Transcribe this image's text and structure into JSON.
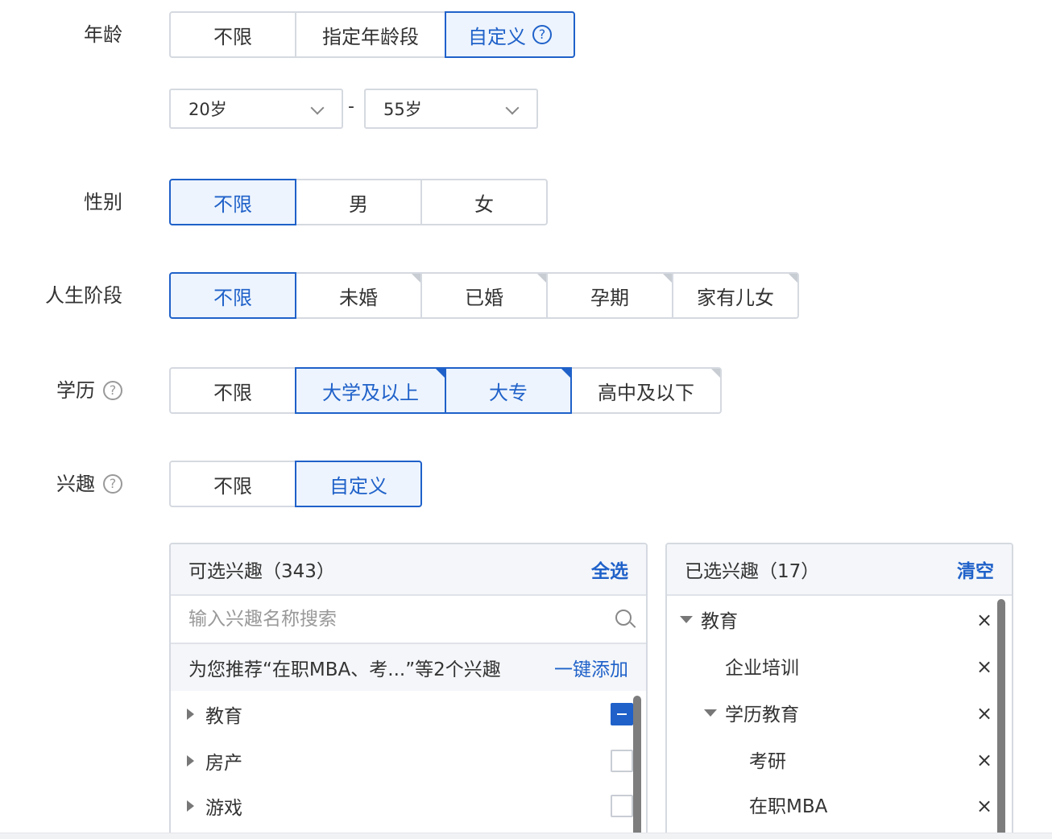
{
  "age": {
    "label": "年龄",
    "options": [
      "不限",
      "指定年龄段",
      "自定义"
    ],
    "selected": "自定义",
    "help_icon": "question-circle-icon",
    "from": "20岁",
    "to": "55岁",
    "range_sep": "-"
  },
  "gender": {
    "label": "性别",
    "options": [
      "不限",
      "男",
      "女"
    ],
    "selected": "不限"
  },
  "life_stage": {
    "label": "人生阶段",
    "options": [
      "不限",
      "未婚",
      "已婚",
      "孕期",
      "家有儿女"
    ],
    "selected": "不限"
  },
  "education": {
    "label": "学历",
    "help_icon": "question-circle-icon",
    "options": [
      "不限",
      "大学及以上",
      "大专",
      "高中及以下"
    ],
    "selected": [
      "大学及以上",
      "大专"
    ]
  },
  "interest": {
    "label": "兴趣",
    "help_icon": "question-circle-icon",
    "options": [
      "不限",
      "自定义"
    ],
    "selected": "自定义"
  },
  "available_panel": {
    "title": "可选兴趣（343）",
    "select_all": "全选",
    "search_placeholder": "输入兴趣名称搜索",
    "recommend_text": "为您推荐“在职MBA、考...”等2个兴趣",
    "recommend_action": "一键添加",
    "items": [
      {
        "label": "教育",
        "state": "partial"
      },
      {
        "label": "房产",
        "state": "unchecked"
      },
      {
        "label": "游戏",
        "state": "unchecked"
      }
    ]
  },
  "selected_panel": {
    "title": "已选兴趣（17）",
    "clear": "清空",
    "remove_symbol": "×",
    "items": [
      {
        "label": "教育",
        "level": 0,
        "expanded": true
      },
      {
        "label": "企业培训",
        "level": 1
      },
      {
        "label": "学历教育",
        "level": 1,
        "expanded": true
      },
      {
        "label": "考研",
        "level": 2
      },
      {
        "label": "在职MBA",
        "level": 2
      }
    ]
  },
  "colors": {
    "accent": "#1f61c9",
    "selected_bg": "#edf4fd",
    "border": "#d5d9e0"
  }
}
